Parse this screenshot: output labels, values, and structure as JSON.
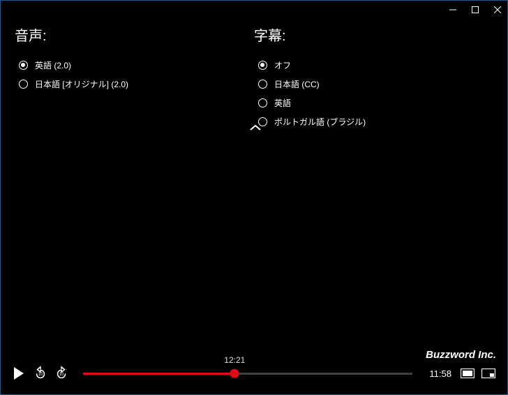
{
  "titlebar": {
    "minimize": "minimize",
    "maximize": "maximize",
    "close": "close"
  },
  "audio": {
    "title": "音声:",
    "options": [
      {
        "label": "英語 (2.0)",
        "selected": true
      },
      {
        "label": "日本語 [オリジナル] (2.0)",
        "selected": false
      }
    ]
  },
  "subtitles": {
    "title": "字幕:",
    "options": [
      {
        "label": "オフ",
        "selected": true
      },
      {
        "label": "日本語 (CC)",
        "selected": false
      },
      {
        "label": "英語",
        "selected": false
      },
      {
        "label": "ポルトガル語 (ブラジル)",
        "selected": false
      }
    ]
  },
  "watermark": "Buzzword Inc.",
  "player": {
    "tooltip_time": "12:21",
    "current_time": "11:58",
    "progress_percent": 46,
    "colors": {
      "accent": "#e50914"
    }
  }
}
